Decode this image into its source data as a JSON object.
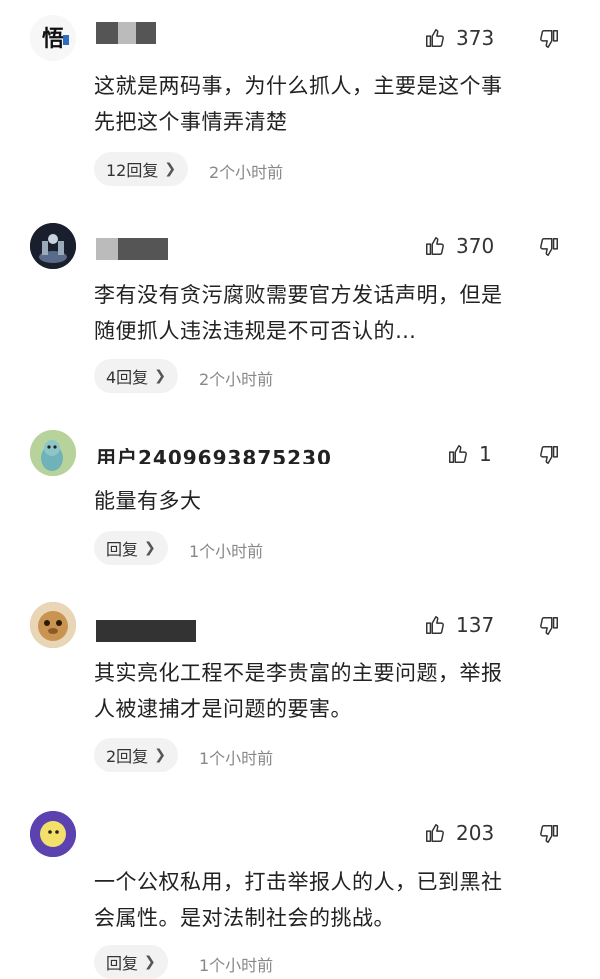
{
  "comments": [
    {
      "username": "",
      "likes": "373",
      "text_lines": [
        "这就是两码事，为什么抓人，主要是这个事",
        "先把这个事情弄清楚"
      ],
      "reply_label": "12回复",
      "time": "2个小时前"
    },
    {
      "username": "",
      "likes": "370",
      "text_lines": [
        "李有没有贪污腐败需要官方发话声明，但是",
        "随便抓人违法违规是不可否认的…"
      ],
      "reply_label": "4回复",
      "time": "2个小时前"
    },
    {
      "username": "用户2409693875230",
      "likes": "1",
      "text_lines": [
        "能量有多大"
      ],
      "reply_label": "回复",
      "time": "1个小时前"
    },
    {
      "username": "",
      "likes": "137",
      "text_lines": [
        "其实亮化工程不是李贵富的主要问题，举报",
        "人被逮捕才是问题的要害。"
      ],
      "reply_label": "2回复",
      "time": "1个小时前"
    },
    {
      "username": "",
      "likes": "203",
      "text_lines": [
        "一个公权私用，打击举报人的人，已到黑社",
        "会属性。是对法制社会的挑战。"
      ],
      "reply_label": "回复",
      "time": "1个小时前"
    }
  ],
  "icons": {
    "like": "thumb-up-icon",
    "dislike": "thumb-down-icon",
    "chevron": "chevron-right-icon"
  },
  "colors": {
    "text": "#222222",
    "meta": "#888888",
    "pill_bg": "#f2f2f2"
  }
}
